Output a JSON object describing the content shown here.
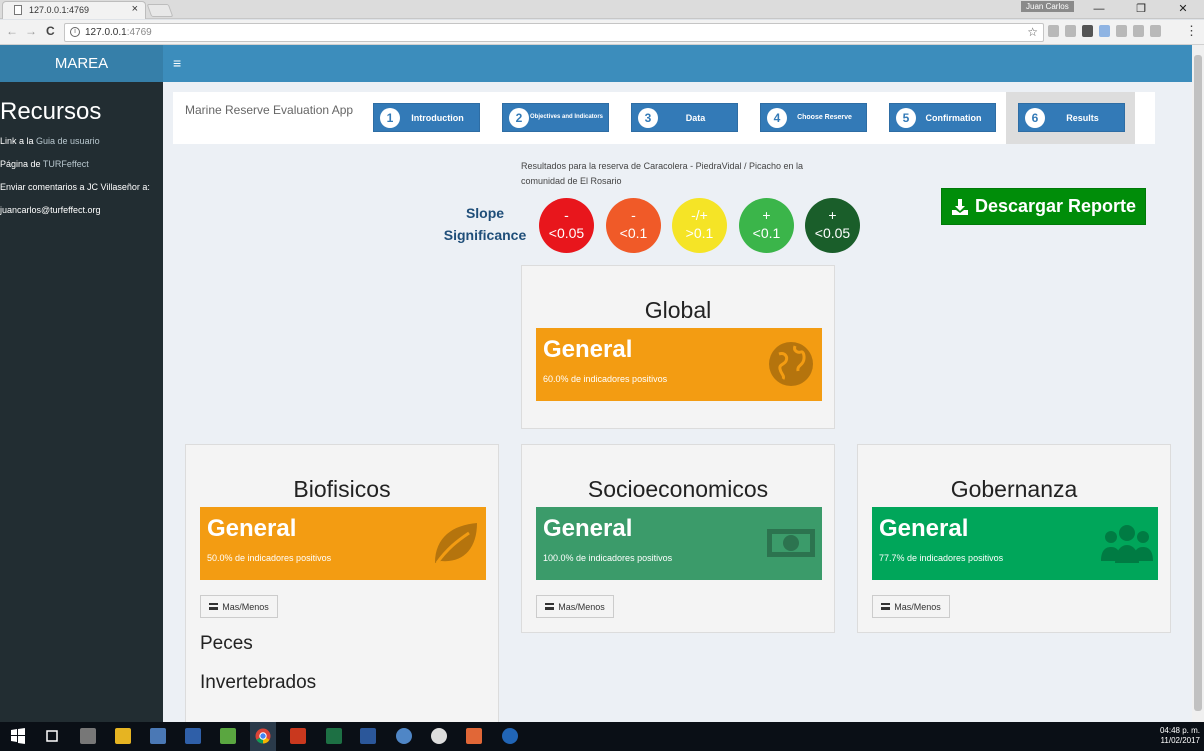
{
  "browser": {
    "tab_title": "127.0.0.1:4769",
    "tab_close": "×",
    "url_host": "127.0.0.1",
    "url_port": ":4769",
    "user_label": "Juan Carlos",
    "win_minimize": "—",
    "win_restore": "❐",
    "win_close": "✕",
    "back_icon": "←",
    "forward_icon": "→",
    "reload_icon": "C",
    "star_icon": "☆",
    "menu_icon": "⋮"
  },
  "app": {
    "logo": "MAREA",
    "menu_icon": "≡"
  },
  "sidebar": {
    "title": "Recursos",
    "link1_prefix": "Link a la ",
    "link1_text": "Guia de usuario",
    "link2_prefix": "Página de ",
    "link2_text": "TURFeffect",
    "link3_text": "Enviar comentarios a JC Villaseñor a:",
    "email": "juancarlos@turfeffect.org"
  },
  "wizard": {
    "app_title": "Marine Reserve Evaluation App",
    "steps": [
      {
        "num": "1",
        "label": "Introduction"
      },
      {
        "num": "2",
        "label": "Objectives and Indicators"
      },
      {
        "num": "3",
        "label": "Data"
      },
      {
        "num": "4",
        "label": "Choose Reserve"
      },
      {
        "num": "5",
        "label": "Confirmation"
      },
      {
        "num": "6",
        "label": "Results"
      }
    ]
  },
  "results": {
    "description": "Resultados para la reserva de Caracolera - PiedraVidal / Picacho en la comunidad de El Rosario",
    "slope_label": "Slope Significance",
    "legend": [
      {
        "sign": "-",
        "value": "<0.05",
        "color": "#e8161c"
      },
      {
        "sign": "-",
        "value": "<0.1",
        "color": "#f05a28"
      },
      {
        "sign": "-/+",
        "value": ">0.1",
        "color": "#f5e426"
      },
      {
        "sign": "+",
        "value": "<0.1",
        "color": "#3bb54a"
      },
      {
        "sign": "+",
        "value": "<0.05",
        "color": "#1a5e2a"
      }
    ],
    "download_label": "Descargar Reporte"
  },
  "panels": {
    "global": {
      "title": "Global",
      "box_title": "General",
      "box_text": "60.0% de indicadores positivos",
      "percent": 60.0,
      "color": "#f39c12",
      "icon": "globe-icon"
    },
    "biofisicos": {
      "title": "Biofisicos",
      "box_title": "General",
      "box_text": "50.0% de indicadores positivos",
      "percent": 50.0,
      "color": "#f39c12",
      "icon": "leaf-icon",
      "button": "Mas/Menos",
      "subitems": [
        "Peces",
        "Invertebrados"
      ]
    },
    "socioeconomicos": {
      "title": "Socioeconomicos",
      "box_title": "General",
      "box_text": "100.0% de indicadores positivos",
      "percent": 100.0,
      "color": "#3b9b6a",
      "icon": "money-icon",
      "button": "Mas/Menos"
    },
    "gobernanza": {
      "title": "Gobernanza",
      "box_title": "General",
      "box_text": "77.7% de indicadores positivos",
      "percent": 77.7,
      "color": "#00a65a",
      "icon": "users-icon",
      "button": "Mas/Menos"
    }
  },
  "taskbar": {
    "time": "04:48 p. m.",
    "date": "11/02/2017"
  }
}
